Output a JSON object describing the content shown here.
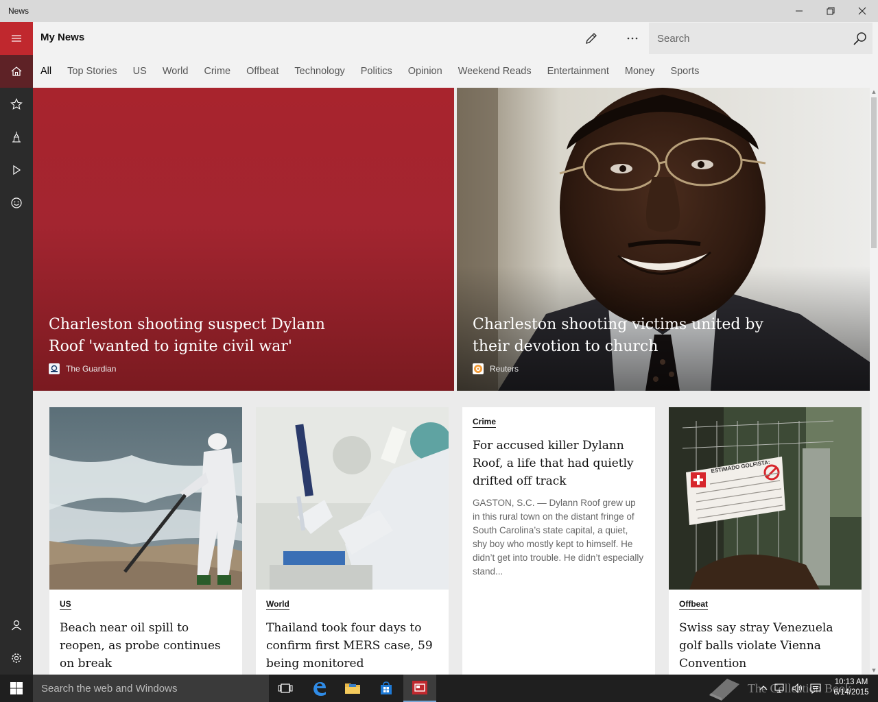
{
  "window": {
    "title": "News",
    "controls": [
      "minimize-icon",
      "restore-icon",
      "close-icon"
    ]
  },
  "header": {
    "title": "My News",
    "search_placeholder": "Search"
  },
  "tabs": [
    {
      "label": "All",
      "active": true
    },
    {
      "label": "Top Stories"
    },
    {
      "label": "US"
    },
    {
      "label": "World"
    },
    {
      "label": "Crime"
    },
    {
      "label": "Offbeat"
    },
    {
      "label": "Technology"
    },
    {
      "label": "Politics"
    },
    {
      "label": "Opinion"
    },
    {
      "label": "Weekend Reads"
    },
    {
      "label": "Entertainment"
    },
    {
      "label": "Money"
    },
    {
      "label": "Sports"
    }
  ],
  "rail": {
    "items": [
      "hamburger-icon",
      "home-icon",
      "star-icon",
      "landmark-icon",
      "play-icon",
      "smiley-icon",
      "user-icon",
      "gear-icon"
    ]
  },
  "hero": [
    {
      "headline": "Charleston shooting suspect Dylann Roof 'wanted to ignite civil war'",
      "source": "The Guardian"
    },
    {
      "headline": "Charleston shooting victims united by their devotion to church",
      "source": "Reuters"
    }
  ],
  "cards": [
    {
      "category": "US",
      "headline": "Beach near oil spill to reopen, as probe continues on break"
    },
    {
      "category": "World",
      "headline": "Thailand took four days to confirm first MERS case, 59 being monitored"
    },
    {
      "category": "Crime",
      "headline": "For accused killer Dylann Roof, a life that had quietly drifted off track",
      "summary": "GASTON, S.C. — Dylann Roof grew up in this rural town on the distant fringe of South Carolina’s state capital, a quiet, shy boy who mostly kept to himself. He didn’t get into trouble. He didn’t especially stand..."
    },
    {
      "category": "Offbeat",
      "headline": "Swiss say stray Venezuela golf balls violate Vienna Convention",
      "sign_text": "ESTIMADO GOLFISTA:"
    }
  ],
  "taskbar": {
    "search_placeholder": "Search the web and Windows",
    "watermark": "The Collection Book",
    "time": "10:13 AM",
    "date": "6/14/2015"
  },
  "colors": {
    "accent": "#c0282e",
    "rail_bg": "#2b2b2b",
    "rail_active": "#5e2226",
    "header_bg": "#f2f2f2",
    "taskbar_bg": "#1f1f1f"
  }
}
